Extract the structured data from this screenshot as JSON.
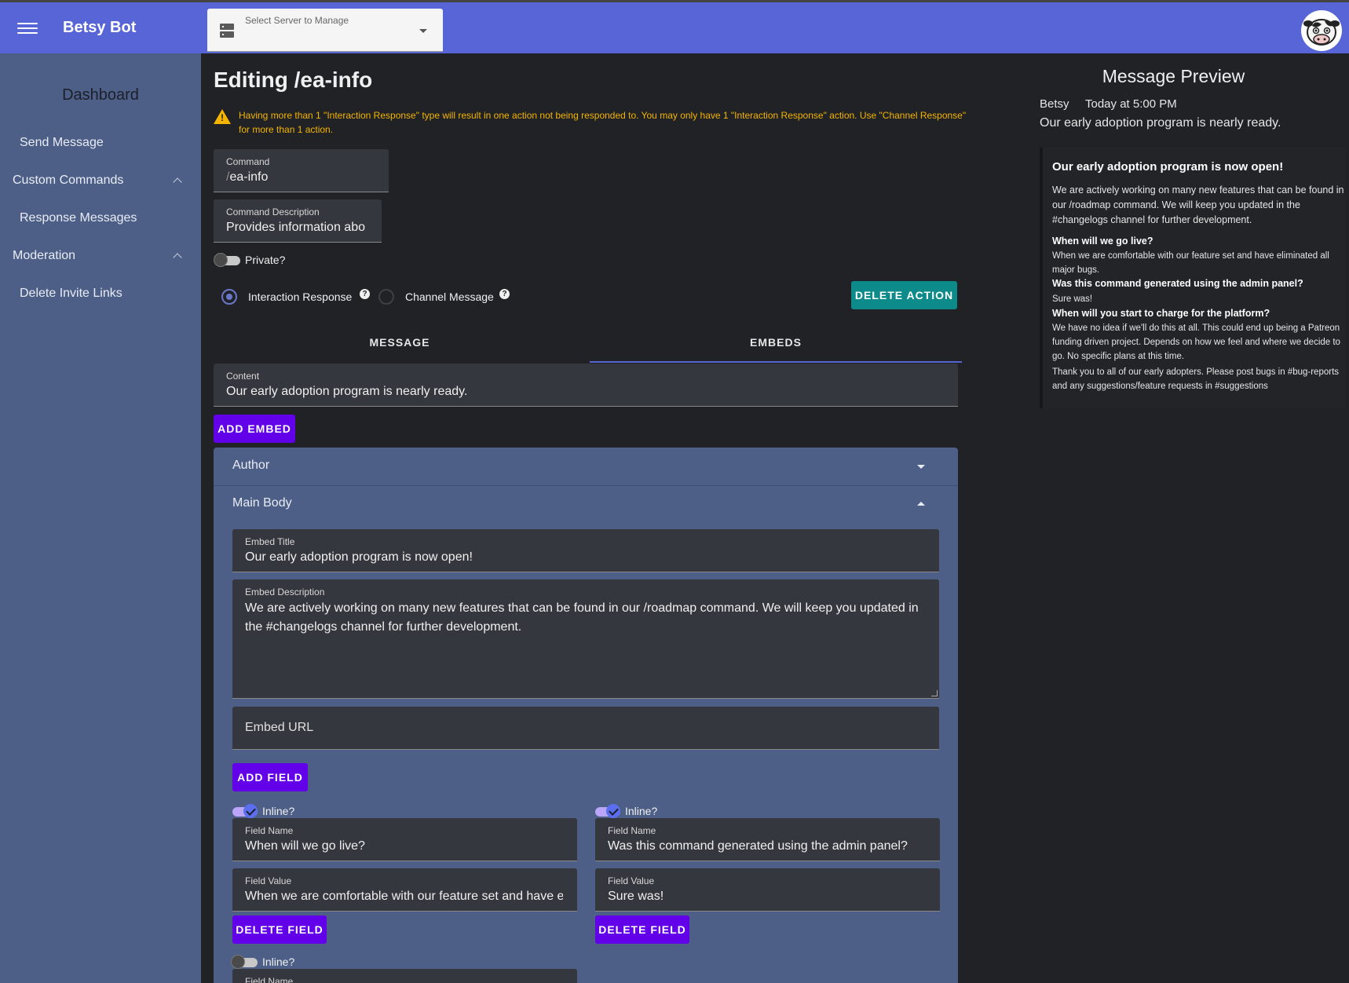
{
  "app": {
    "title": "Betsy Bot",
    "server_select_label": "Select Server to Manage"
  },
  "sidebar": {
    "heading": "Dashboard",
    "items": [
      "Send Message",
      "Custom Commands",
      "Response Messages",
      "Moderation",
      "Delete Invite Links"
    ]
  },
  "editor": {
    "title": "Editing /ea-info",
    "warning": "Having more than 1 \"Interaction Response\" type will result in one action not being responded to. You may only have 1 \"Interaction Response\" action. Use \"Channel Response\" for more than 1 action.",
    "command_label": "Command",
    "command_prefix": "/",
    "command_value": "ea-info",
    "description_label": "Command Description",
    "description_value": "Provides information abo",
    "private_label": "Private?",
    "interaction_response_label": "Interaction Response",
    "channel_message_label": "Channel Message",
    "help_glyph": "?",
    "delete_action_label": "DELETE ACTION",
    "tabs": [
      "MESSAGE",
      "EMBEDS"
    ],
    "content_label": "Content",
    "content_value": "Our early adoption program is nearly ready.",
    "add_embed_label": "ADD EMBED",
    "author_label": "Author",
    "main_body_label": "Main Body",
    "embed_title_label": "Embed Title",
    "embed_title_value": "Our early adoption program is now open!",
    "embed_description_label": "Embed Description",
    "embed_description_value": "We are actively working on many new features that can be found in our /roadmap command. We will keep you updated in the #changelogs channel for further development.",
    "embed_url_placeholder": "Embed URL",
    "add_field_label": "ADD FIELD",
    "inline_label": "Inline?",
    "field_name_label": "Field Name",
    "field_value_label": "Field Value",
    "delete_field_label": "DELETE FIELD",
    "fields": [
      {
        "name": "When will we go live?",
        "value": "When we are comfortable with our feature set and have e",
        "inline": true
      },
      {
        "name": "Was this command generated using the admin panel?",
        "value": "Sure was!",
        "inline": true
      },
      {
        "inline": false
      }
    ]
  },
  "preview": {
    "heading": "Message Preview",
    "author": "Betsy",
    "timestamp": "Today at 5:00 PM",
    "content": "Our early adoption program is nearly ready.",
    "embed_title": "Our early adoption program is now open!",
    "embed_description": "We are actively working on many new features that can be found in our /roadmap command. We will keep you updated in the #changelogs channel for further development.",
    "fields": [
      {
        "name": "When will we go live?",
        "value": "When we are comfortable with our feature set and have eliminated all major bugs."
      },
      {
        "name": "Was this command generated using the admin panel?",
        "value": "Sure was!"
      },
      {
        "name": "When will you start to charge for the platform?",
        "value": "We have no idea if we'll do this at all. This could end up being a Patreon funding driven project. Depends on how we feel and where we decide to go. No specific plans at this time."
      }
    ],
    "footer_text": "Thank you to all of our early adopters. Please post bugs in #bug-reports and any suggestions/feature requests in #suggestions"
  },
  "colors": {
    "appbar": "#5865d6",
    "sidebar": "#4e5f87",
    "accent_purple": "#6200ea",
    "accent_teal": "#0d8a8a",
    "warning": "#f5b400"
  },
  "icons": {
    "menu": "hamburger-icon",
    "server": "server-icon",
    "warning": "warning-icon",
    "avatar": "cow-avatar"
  }
}
